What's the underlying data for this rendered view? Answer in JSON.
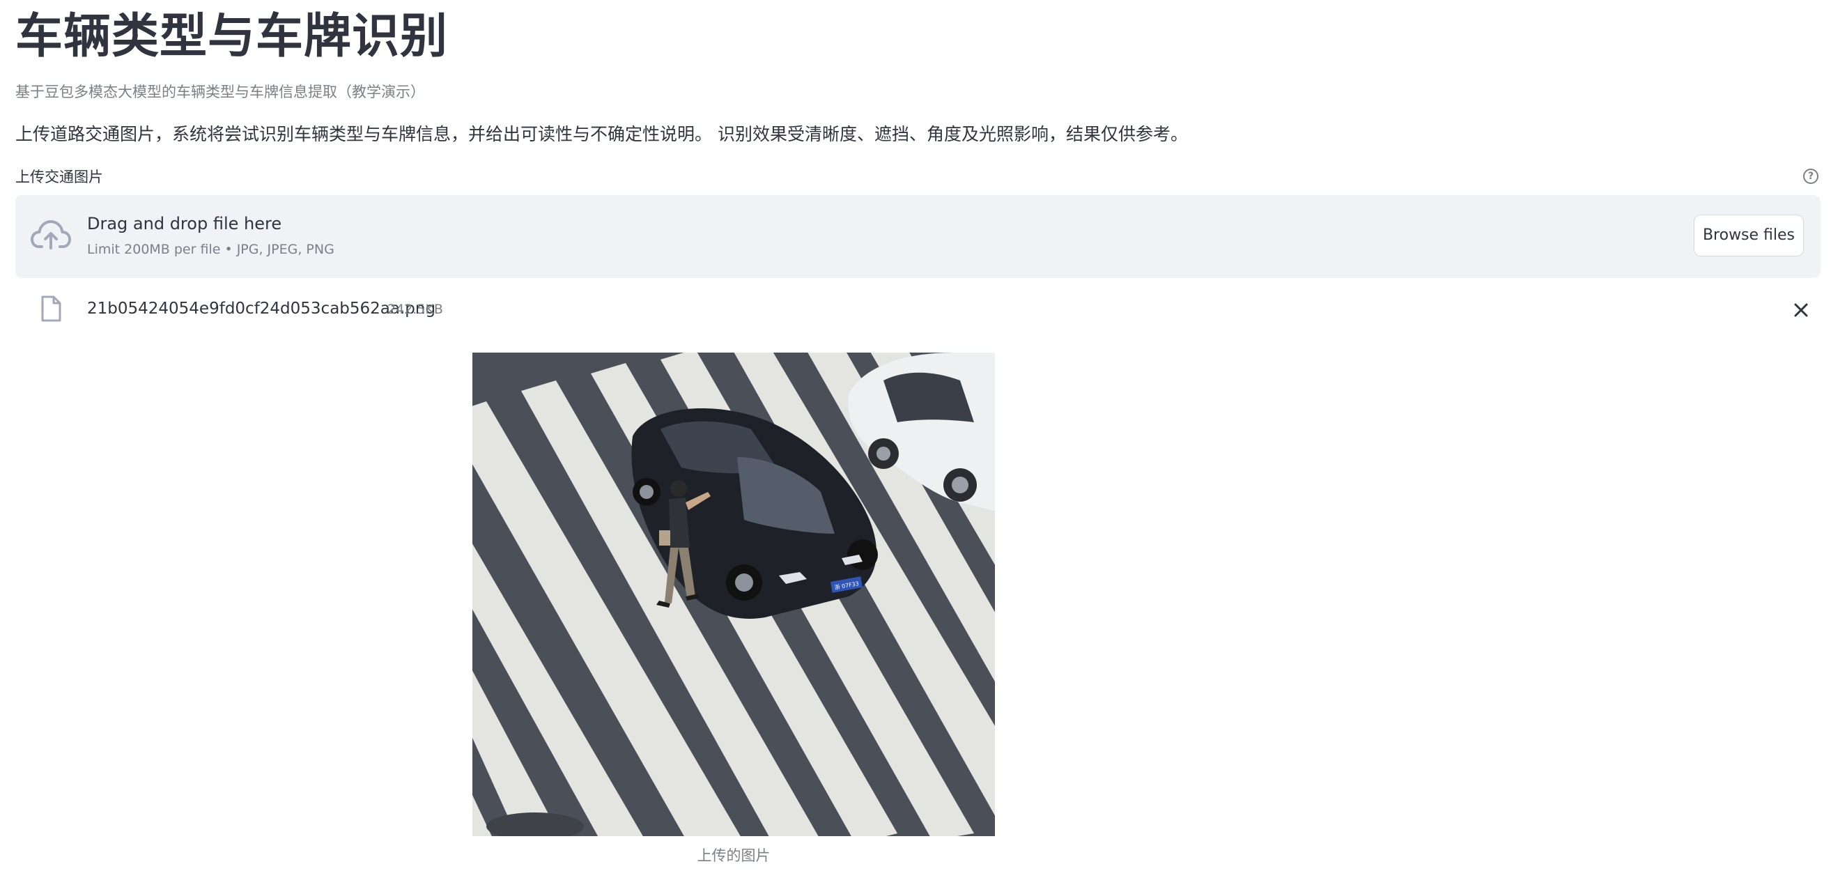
{
  "page": {
    "title": "车辆类型与车牌识别",
    "subtitle": "基于豆包多模态大模型的车辆类型与车牌信息提取（教学演示）",
    "intro": "上传道路交通图片，系统将尝试识别车辆类型与车牌信息，并给出可读性与不确定性说明。 识别效果受清晰度、遮挡、角度及光照影响，结果仅供参考。"
  },
  "uploader": {
    "label": "上传交通图片",
    "help_icon": "question-circle-icon",
    "drop_title": "Drag and drop file here",
    "drop_limit": "Limit 200MB per file • JPG, JPEG, PNG",
    "browse_label": "Browse files",
    "cloud_icon": "cloud-upload-icon"
  },
  "uploaded_file": {
    "name": "21b05424054e9fd0cf24d053cab562aa.png",
    "size": "242.5KB",
    "file_icon": "file-icon",
    "remove_icon": "close-icon"
  },
  "preview": {
    "caption": "上传的图片",
    "plate_text": "浙 07F33"
  },
  "colors": {
    "text": "#31333f",
    "muted": "#7d7f87",
    "dropzone_bg": "#f0f2f6",
    "icon": "#a3a8b8"
  }
}
